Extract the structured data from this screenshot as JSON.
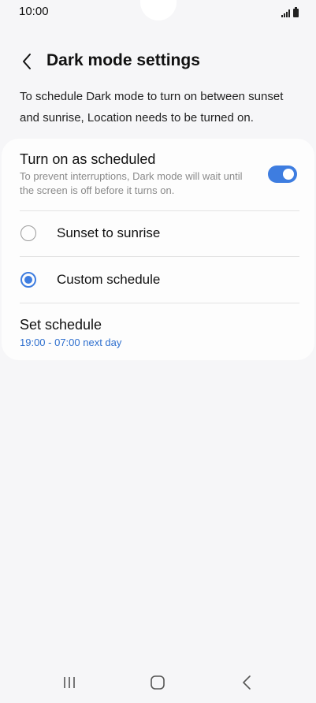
{
  "status_bar": {
    "time": "10:00",
    "icons": [
      "signal-icon",
      "battery-icon"
    ]
  },
  "header": {
    "back_icon": "back-chevron-icon",
    "title": "Dark mode settings"
  },
  "intro_text": "To schedule Dark mode to turn on between sunset and sunrise, Location needs to be turned on.",
  "schedule_card": {
    "toggle": {
      "title": "Turn on as scheduled",
      "description": "To prevent interruptions, Dark mode will wait until the screen is off before it turns on.",
      "enabled": true
    },
    "options": [
      {
        "label": "Sunset to sunrise",
        "selected": false
      },
      {
        "label": "Custom schedule",
        "selected": true
      }
    ],
    "set_schedule": {
      "title": "Set schedule",
      "value": "19:00 - 07:00 next day"
    }
  },
  "nav_bar": {
    "buttons": [
      "recent-apps-icon",
      "home-icon",
      "back-icon"
    ]
  },
  "colors": {
    "accent": "#3e7de0",
    "link": "#2e6fce",
    "background": "#f6f6f8",
    "card": "#fdfdfd",
    "secondary_text": "#8a8a8a"
  }
}
